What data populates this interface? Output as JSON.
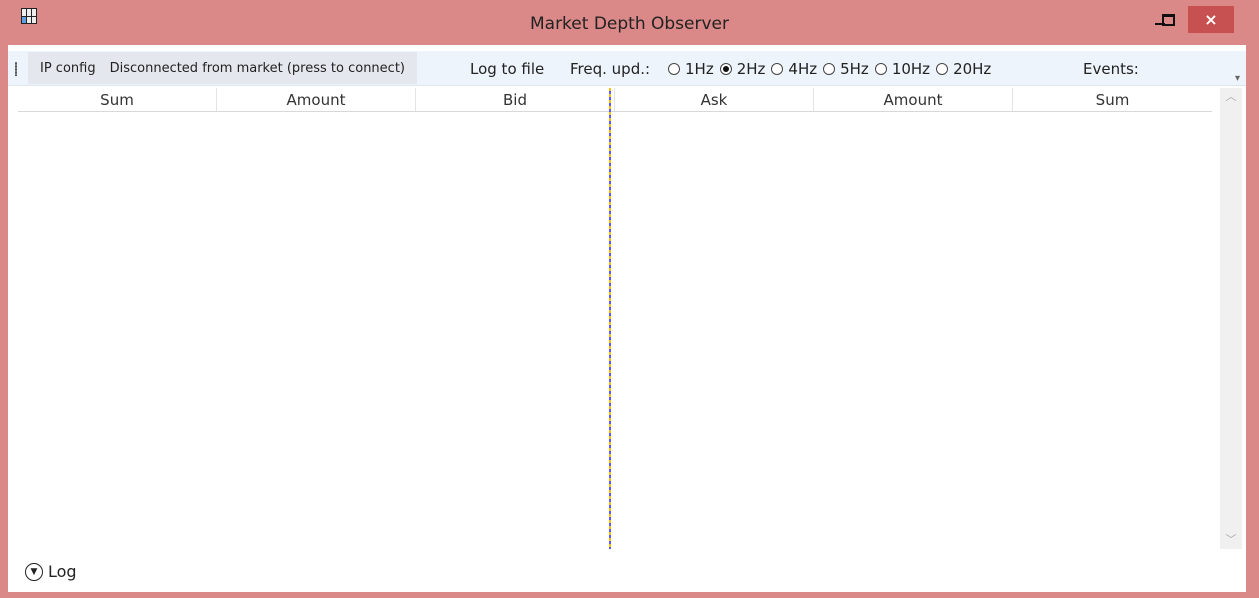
{
  "window": {
    "title": "Market Depth Observer",
    "close_glyph": "×"
  },
  "toolbar": {
    "ip_config": "IP config",
    "connect": "Disconnected from market (press to connect)",
    "log_to_file": "Log to file",
    "freq_label": "Freq. upd.:",
    "freq_options": [
      {
        "label": "1Hz",
        "selected": false
      },
      {
        "label": "2Hz",
        "selected": true
      },
      {
        "label": "4Hz",
        "selected": false
      },
      {
        "label": "5Hz",
        "selected": false
      },
      {
        "label": "10Hz",
        "selected": false
      },
      {
        "label": "20Hz",
        "selected": false
      }
    ],
    "events": "Events:"
  },
  "grid": {
    "columns": [
      "Sum",
      "Amount",
      "Bid",
      "Ask",
      "Amount",
      "Sum"
    ]
  },
  "footer": {
    "log": "Log"
  },
  "colors": {
    "frame": "#da8888",
    "close": "#c75050",
    "toolbar": "#eef4fb"
  }
}
